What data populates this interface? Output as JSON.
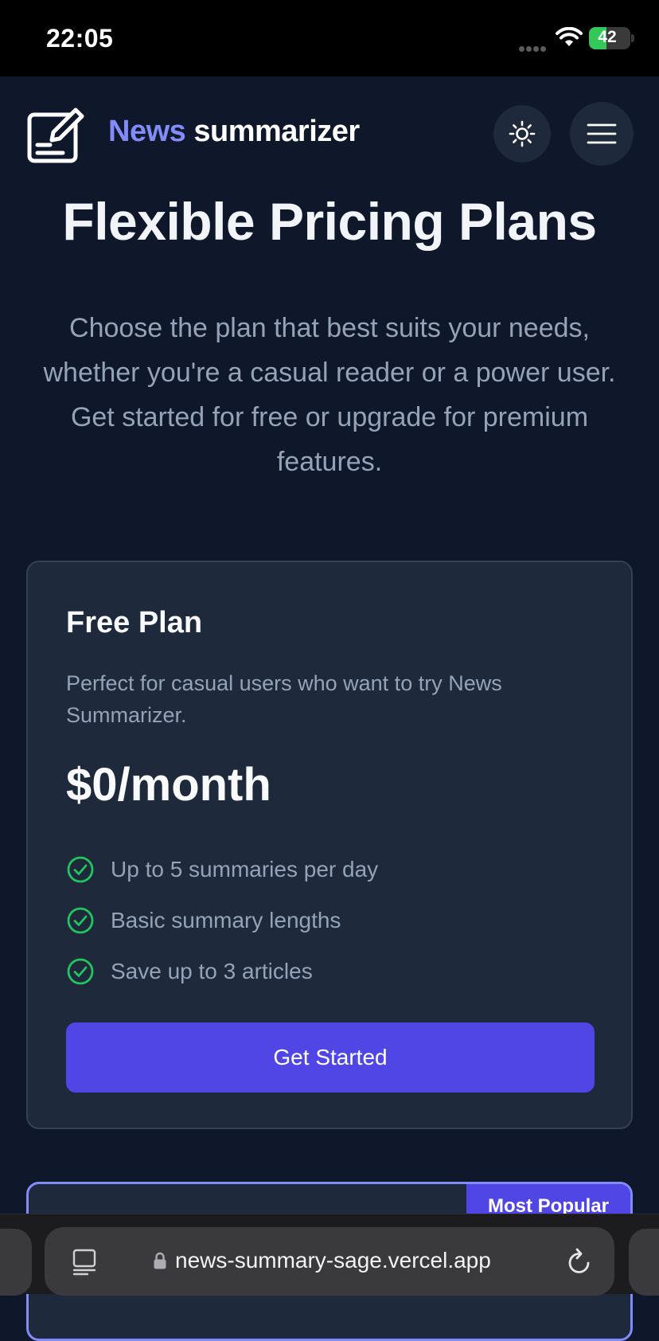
{
  "status_bar": {
    "time": "22:05",
    "battery": "42",
    "battery_level": 0.42,
    "icons": [
      "signal-dots-icon",
      "wifi-icon",
      "battery-charging-icon"
    ]
  },
  "header": {
    "brand_accent": "News",
    "brand_rest": "summarizer",
    "logo_icon": "edit-note-icon",
    "theme_toggle_icon": "sun-icon",
    "menu_icon": "hamburger-menu-icon"
  },
  "hero": {
    "title": "Flexible Pricing Plans",
    "subtitle_lines": [
      "Choose the plan that best suits your needs,",
      "whether you're a casual reader or a power user.",
      "Get started for free or upgrade for premium",
      "features."
    ]
  },
  "plans": [
    {
      "title": "Free Plan",
      "description": "Perfect for casual users who want to try News Summarizer.",
      "price": "$0/month",
      "features": [
        "Up to 5 summaries per day",
        "Basic summary lengths",
        "Save up to 3 articles"
      ],
      "cta_label": "Get Started"
    },
    {
      "badge": "Most Popular"
    }
  ],
  "browser": {
    "url": "news-summary-sage.vercel.app",
    "icons": [
      "tabs-icon",
      "lock-icon",
      "reload-icon"
    ]
  },
  "colors": {
    "background": "#0f172a",
    "card": "#1e293b",
    "accent": "#818cf8",
    "button": "#4f46e5",
    "check": "#22c55e"
  }
}
